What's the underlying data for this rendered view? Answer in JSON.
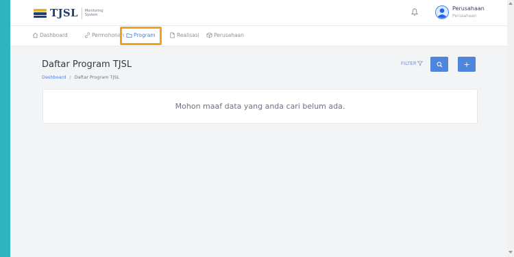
{
  "brand": {
    "name": "TJSL",
    "subtitle": "Monitoring System",
    "colors": {
      "gold": "#e6b422",
      "navy": "#1a3d7c"
    }
  },
  "header": {
    "notification_icon": "bell-icon",
    "avatar_icon": "user-avatar-icon",
    "user_name": "Perusahaan",
    "user_role": "Perusahaan"
  },
  "nav": {
    "items": [
      {
        "label": "Dashboard",
        "icon": "home-icon",
        "active": false
      },
      {
        "label": "Permohonan",
        "icon": "link-icon",
        "active": false
      },
      {
        "label": "Program",
        "icon": "folder-icon",
        "active": true
      },
      {
        "label": "Realisasi",
        "icon": "document-icon",
        "active": false
      },
      {
        "label": "Perusahaan",
        "icon": "building-icon",
        "active": false
      }
    ],
    "highlight_color": "#f5a316",
    "active_color": "#4b7fd1"
  },
  "page": {
    "title": "Daftar Program TJSL",
    "breadcrumb": {
      "home": "Dashboard",
      "separator": "/",
      "current": "Daftar Program TJSL"
    },
    "filter_label": "FILTER",
    "filter_icon": "filter-icon",
    "search_button_icon": "search-icon",
    "add_button_label": "+",
    "empty_message": "Mohon maaf data yang anda cari belum ada.",
    "button_color": "#4d86da"
  }
}
